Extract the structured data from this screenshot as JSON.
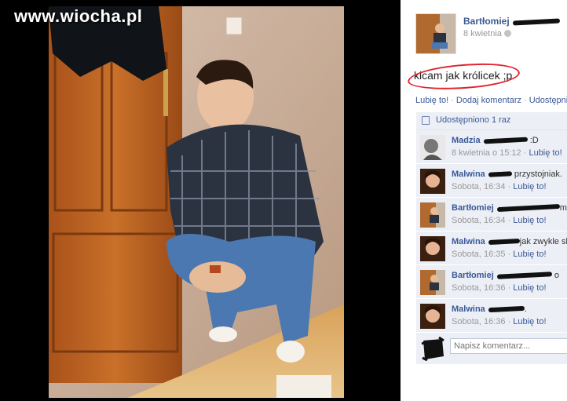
{
  "watermark": "www.wiocha.pl",
  "post": {
    "author": "Bartłomiej",
    "date": "8 kwietnia",
    "status_text": "kicam jak królicek ;p",
    "actions": [
      "Lubię to!",
      "Dodaj komentarz",
      "Udostępnij"
    ],
    "shares_text": "Udostępniono 1 raz"
  },
  "comments": [
    {
      "name": "Madzia",
      "text": ":D",
      "time": "8 kwietnia o 15:12",
      "like": "Lubię to!"
    },
    {
      "name": "Malwina",
      "text": "przystojniak.",
      "time": "Sobota, 16:34",
      "like": "Lubię to!"
    },
    {
      "name": "Bartłomiej",
      "text": "m",
      "time": "Sobota, 16:34",
      "like": "Lubię to!"
    },
    {
      "name": "Malwina",
      "text": "jak zwykle sk",
      "time": "Sobota, 16:35",
      "like": "Lubię to!"
    },
    {
      "name": "Bartłomiej",
      "text": "o",
      "time": "Sobota, 16:36",
      "like": "Lubię to!"
    },
    {
      "name": "Malwina",
      "text": ".",
      "time": "Sobota, 16:36",
      "like": "Lubię to!"
    }
  ],
  "composer": {
    "placeholder": "Napisz komentarz..."
  },
  "colors": {
    "link": "#3b5998",
    "highlight_circle": "#e0242c",
    "comment_bg": "#eceff5"
  }
}
